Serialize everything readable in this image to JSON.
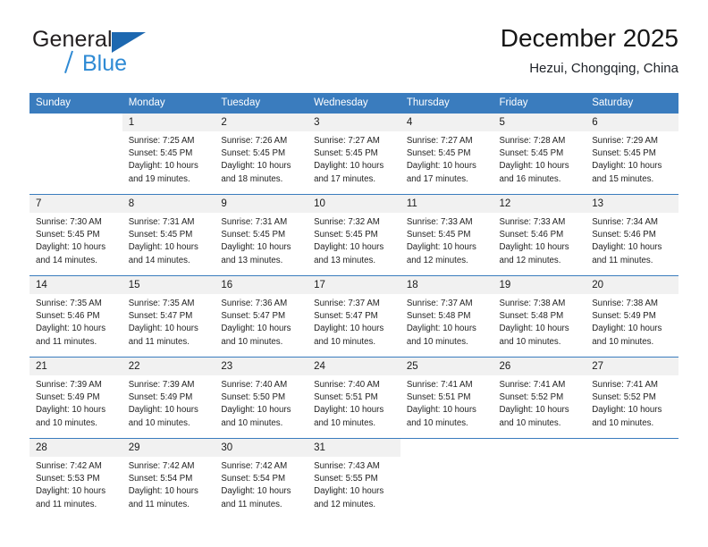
{
  "brand": {
    "name_top": "General",
    "name_bottom": "Blue",
    "accent_dark": "#1d68b0",
    "accent_light": "#2e8ad4"
  },
  "header": {
    "title": "December 2025",
    "subtitle": "Hezui, Chongqing, China"
  },
  "calendar": {
    "header_color": "#3a7cbe",
    "daynum_band_color": "#f1f1f1",
    "weekdays": [
      "Sunday",
      "Monday",
      "Tuesday",
      "Wednesday",
      "Thursday",
      "Friday",
      "Saturday"
    ],
    "weeks": [
      [
        {
          "day": "",
          "sunrise": "",
          "sunset": "",
          "daylight_line1": "",
          "daylight_line2": ""
        },
        {
          "day": "1",
          "sunrise": "Sunrise: 7:25 AM",
          "sunset": "Sunset: 5:45 PM",
          "daylight_line1": "Daylight: 10 hours",
          "daylight_line2": "and 19 minutes."
        },
        {
          "day": "2",
          "sunrise": "Sunrise: 7:26 AM",
          "sunset": "Sunset: 5:45 PM",
          "daylight_line1": "Daylight: 10 hours",
          "daylight_line2": "and 18 minutes."
        },
        {
          "day": "3",
          "sunrise": "Sunrise: 7:27 AM",
          "sunset": "Sunset: 5:45 PM",
          "daylight_line1": "Daylight: 10 hours",
          "daylight_line2": "and 17 minutes."
        },
        {
          "day": "4",
          "sunrise": "Sunrise: 7:27 AM",
          "sunset": "Sunset: 5:45 PM",
          "daylight_line1": "Daylight: 10 hours",
          "daylight_line2": "and 17 minutes."
        },
        {
          "day": "5",
          "sunrise": "Sunrise: 7:28 AM",
          "sunset": "Sunset: 5:45 PM",
          "daylight_line1": "Daylight: 10 hours",
          "daylight_line2": "and 16 minutes."
        },
        {
          "day": "6",
          "sunrise": "Sunrise: 7:29 AM",
          "sunset": "Sunset: 5:45 PM",
          "daylight_line1": "Daylight: 10 hours",
          "daylight_line2": "and 15 minutes."
        }
      ],
      [
        {
          "day": "7",
          "sunrise": "Sunrise: 7:30 AM",
          "sunset": "Sunset: 5:45 PM",
          "daylight_line1": "Daylight: 10 hours",
          "daylight_line2": "and 14 minutes."
        },
        {
          "day": "8",
          "sunrise": "Sunrise: 7:31 AM",
          "sunset": "Sunset: 5:45 PM",
          "daylight_line1": "Daylight: 10 hours",
          "daylight_line2": "and 14 minutes."
        },
        {
          "day": "9",
          "sunrise": "Sunrise: 7:31 AM",
          "sunset": "Sunset: 5:45 PM",
          "daylight_line1": "Daylight: 10 hours",
          "daylight_line2": "and 13 minutes."
        },
        {
          "day": "10",
          "sunrise": "Sunrise: 7:32 AM",
          "sunset": "Sunset: 5:45 PM",
          "daylight_line1": "Daylight: 10 hours",
          "daylight_line2": "and 13 minutes."
        },
        {
          "day": "11",
          "sunrise": "Sunrise: 7:33 AM",
          "sunset": "Sunset: 5:45 PM",
          "daylight_line1": "Daylight: 10 hours",
          "daylight_line2": "and 12 minutes."
        },
        {
          "day": "12",
          "sunrise": "Sunrise: 7:33 AM",
          "sunset": "Sunset: 5:46 PM",
          "daylight_line1": "Daylight: 10 hours",
          "daylight_line2": "and 12 minutes."
        },
        {
          "day": "13",
          "sunrise": "Sunrise: 7:34 AM",
          "sunset": "Sunset: 5:46 PM",
          "daylight_line1": "Daylight: 10 hours",
          "daylight_line2": "and 11 minutes."
        }
      ],
      [
        {
          "day": "14",
          "sunrise": "Sunrise: 7:35 AM",
          "sunset": "Sunset: 5:46 PM",
          "daylight_line1": "Daylight: 10 hours",
          "daylight_line2": "and 11 minutes."
        },
        {
          "day": "15",
          "sunrise": "Sunrise: 7:35 AM",
          "sunset": "Sunset: 5:47 PM",
          "daylight_line1": "Daylight: 10 hours",
          "daylight_line2": "and 11 minutes."
        },
        {
          "day": "16",
          "sunrise": "Sunrise: 7:36 AM",
          "sunset": "Sunset: 5:47 PM",
          "daylight_line1": "Daylight: 10 hours",
          "daylight_line2": "and 10 minutes."
        },
        {
          "day": "17",
          "sunrise": "Sunrise: 7:37 AM",
          "sunset": "Sunset: 5:47 PM",
          "daylight_line1": "Daylight: 10 hours",
          "daylight_line2": "and 10 minutes."
        },
        {
          "day": "18",
          "sunrise": "Sunrise: 7:37 AM",
          "sunset": "Sunset: 5:48 PM",
          "daylight_line1": "Daylight: 10 hours",
          "daylight_line2": "and 10 minutes."
        },
        {
          "day": "19",
          "sunrise": "Sunrise: 7:38 AM",
          "sunset": "Sunset: 5:48 PM",
          "daylight_line1": "Daylight: 10 hours",
          "daylight_line2": "and 10 minutes."
        },
        {
          "day": "20",
          "sunrise": "Sunrise: 7:38 AM",
          "sunset": "Sunset: 5:49 PM",
          "daylight_line1": "Daylight: 10 hours",
          "daylight_line2": "and 10 minutes."
        }
      ],
      [
        {
          "day": "21",
          "sunrise": "Sunrise: 7:39 AM",
          "sunset": "Sunset: 5:49 PM",
          "daylight_line1": "Daylight: 10 hours",
          "daylight_line2": "and 10 minutes."
        },
        {
          "day": "22",
          "sunrise": "Sunrise: 7:39 AM",
          "sunset": "Sunset: 5:49 PM",
          "daylight_line1": "Daylight: 10 hours",
          "daylight_line2": "and 10 minutes."
        },
        {
          "day": "23",
          "sunrise": "Sunrise: 7:40 AM",
          "sunset": "Sunset: 5:50 PM",
          "daylight_line1": "Daylight: 10 hours",
          "daylight_line2": "and 10 minutes."
        },
        {
          "day": "24",
          "sunrise": "Sunrise: 7:40 AM",
          "sunset": "Sunset: 5:51 PM",
          "daylight_line1": "Daylight: 10 hours",
          "daylight_line2": "and 10 minutes."
        },
        {
          "day": "25",
          "sunrise": "Sunrise: 7:41 AM",
          "sunset": "Sunset: 5:51 PM",
          "daylight_line1": "Daylight: 10 hours",
          "daylight_line2": "and 10 minutes."
        },
        {
          "day": "26",
          "sunrise": "Sunrise: 7:41 AM",
          "sunset": "Sunset: 5:52 PM",
          "daylight_line1": "Daylight: 10 hours",
          "daylight_line2": "and 10 minutes."
        },
        {
          "day": "27",
          "sunrise": "Sunrise: 7:41 AM",
          "sunset": "Sunset: 5:52 PM",
          "daylight_line1": "Daylight: 10 hours",
          "daylight_line2": "and 10 minutes."
        }
      ],
      [
        {
          "day": "28",
          "sunrise": "Sunrise: 7:42 AM",
          "sunset": "Sunset: 5:53 PM",
          "daylight_line1": "Daylight: 10 hours",
          "daylight_line2": "and 11 minutes."
        },
        {
          "day": "29",
          "sunrise": "Sunrise: 7:42 AM",
          "sunset": "Sunset: 5:54 PM",
          "daylight_line1": "Daylight: 10 hours",
          "daylight_line2": "and 11 minutes."
        },
        {
          "day": "30",
          "sunrise": "Sunrise: 7:42 AM",
          "sunset": "Sunset: 5:54 PM",
          "daylight_line1": "Daylight: 10 hours",
          "daylight_line2": "and 11 minutes."
        },
        {
          "day": "31",
          "sunrise": "Sunrise: 7:43 AM",
          "sunset": "Sunset: 5:55 PM",
          "daylight_line1": "Daylight: 10 hours",
          "daylight_line2": "and 12 minutes."
        },
        {
          "day": "",
          "sunrise": "",
          "sunset": "",
          "daylight_line1": "",
          "daylight_line2": ""
        },
        {
          "day": "",
          "sunrise": "",
          "sunset": "",
          "daylight_line1": "",
          "daylight_line2": ""
        },
        {
          "day": "",
          "sunrise": "",
          "sunset": "",
          "daylight_line1": "",
          "daylight_line2": ""
        }
      ]
    ]
  }
}
